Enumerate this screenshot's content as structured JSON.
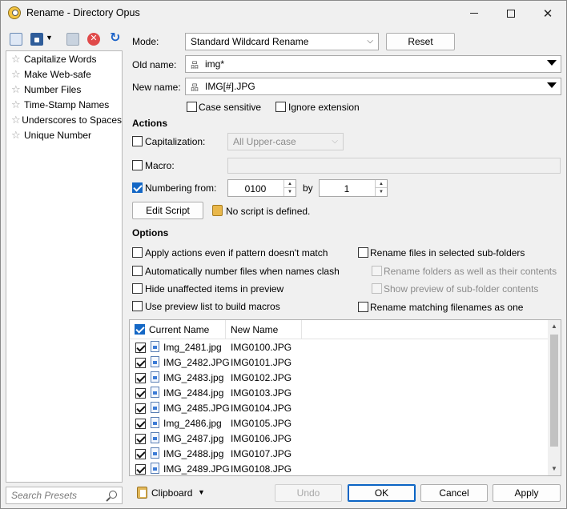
{
  "window": {
    "title": "Rename - Directory Opus"
  },
  "toolbar": {
    "icons": [
      "save-preset-icon",
      "save-preset-dropdown-icon",
      "print-icon",
      "delete-icon",
      "refresh-icon"
    ]
  },
  "presets": {
    "items": [
      {
        "label": "Capitalize Words"
      },
      {
        "label": "Make Web-safe"
      },
      {
        "label": "Number Files"
      },
      {
        "label": "Time-Stamp Names"
      },
      {
        "label": "Underscores to Spaces"
      },
      {
        "label": "Unique Number"
      }
    ],
    "search_placeholder": "Search Presets"
  },
  "mode": {
    "label": "Mode:",
    "value": "Standard Wildcard Rename",
    "reset_label": "Reset"
  },
  "old_name": {
    "label": "Old name:",
    "value": "img*"
  },
  "new_name": {
    "label": "New name:",
    "value": "IMG[#].JPG"
  },
  "case_sensitive": {
    "label": "Case sensitive",
    "checked": false
  },
  "ignore_extension": {
    "label": "Ignore extension",
    "checked": false
  },
  "actions": {
    "heading": "Actions",
    "capitalization": {
      "label": "Capitalization:",
      "value": "All Upper-case",
      "checked": false
    },
    "macro": {
      "label": "Macro:",
      "checked": false
    },
    "numbering": {
      "label": "Numbering from:",
      "from": "0100",
      "by_label": "by",
      "by": "1",
      "checked": true
    },
    "edit_script_label": "Edit Script",
    "script_status": "No script is defined."
  },
  "options": {
    "heading": "Options",
    "left": [
      {
        "label": "Apply actions even if pattern doesn't match",
        "checked": false
      },
      {
        "label": "Automatically number files when names clash",
        "checked": false
      },
      {
        "label": "Hide unaffected items in preview",
        "checked": false
      },
      {
        "label": "Use preview list to build macros",
        "checked": false
      }
    ],
    "right": [
      {
        "label": "Rename files in selected sub-folders",
        "checked": false
      },
      {
        "label": "Rename folders as well as their contents",
        "checked": false,
        "disabled": true
      },
      {
        "label": "Show preview of sub-folder contents",
        "checked": false,
        "disabled": true
      },
      {
        "label": "Rename matching filenames as one",
        "checked": false
      }
    ]
  },
  "file_list": {
    "columns": [
      "Current Name",
      "New Name"
    ],
    "rows": [
      {
        "current": "Img_2481.jpg",
        "new": "IMG0100.JPG"
      },
      {
        "current": "IMG_2482.JPG",
        "new": "IMG0101.JPG"
      },
      {
        "current": "IMG_2483.jpg",
        "new": "IMG0102.JPG"
      },
      {
        "current": "IMG_2484.jpg",
        "new": "IMG0103.JPG"
      },
      {
        "current": "IMG_2485.JPG",
        "new": "IMG0104.JPG"
      },
      {
        "current": "Img_2486.jpg",
        "new": "IMG0105.JPG"
      },
      {
        "current": "IMG_2487.jpg",
        "new": "IMG0106.JPG"
      },
      {
        "current": "IMG_2488.jpg",
        "new": "IMG0107.JPG"
      },
      {
        "current": "IMG_2489.JPG",
        "new": "IMG0108.JPG"
      }
    ]
  },
  "footer": {
    "clipboard_label": "Clipboard",
    "undo_label": "Undo",
    "ok_label": "OK",
    "cancel_label": "Cancel",
    "apply_label": "Apply"
  }
}
